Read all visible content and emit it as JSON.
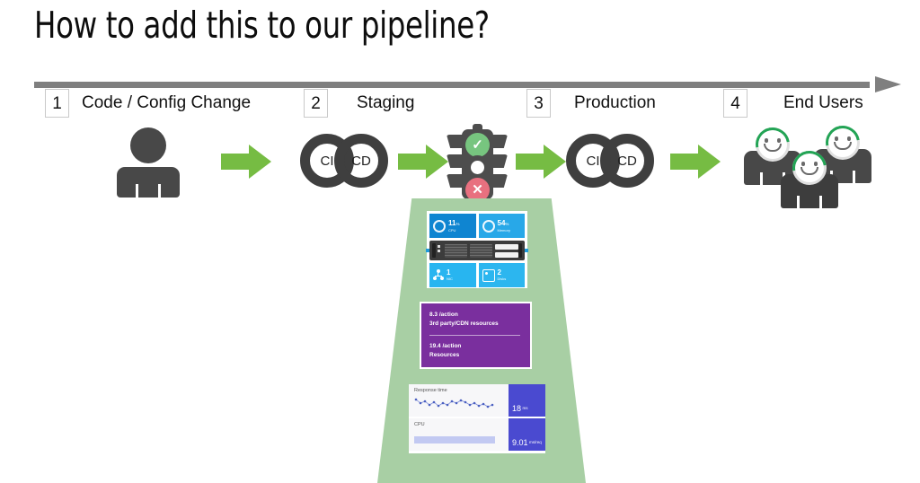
{
  "slide": {
    "title": "How to add this to our pipeline?",
    "background": "#ffffff"
  },
  "colors": {
    "accent_green": "#76bc43",
    "spotlight_green": "#a8cfa4",
    "timeline_gray": "#7f7f7f",
    "icon_gray": "#484848",
    "purple": "#7a2f9e",
    "blue_dark": "#0f85d1",
    "blue_light": "#28a8e8",
    "badge_blue": "#4a4ad0",
    "status_green": "#77c57f",
    "status_red": "#e8707f",
    "arc_green": "#23a455"
  },
  "timeline": {
    "steps": [
      {
        "number": "1",
        "label": "Code / Config Change"
      },
      {
        "number": "2",
        "label": "Staging"
      },
      {
        "number": "3",
        "label": "Production"
      },
      {
        "number": "4",
        "label": "End Users"
      }
    ]
  },
  "stages": {
    "code_change": {
      "icon": "person-icon"
    },
    "ci_cd_1": {
      "left_ring": "CI",
      "right_ring": "CD"
    },
    "ci_cd_2": {
      "left_ring": "CI",
      "right_ring": "CD"
    },
    "traffic_light": {
      "green_glyph": "✓",
      "red_glyph": "✕",
      "middle_state": "off"
    },
    "end_users": {
      "count": 3,
      "expression": "smiley"
    }
  },
  "monitoring": {
    "server_card": {
      "cpu": {
        "value": "11",
        "unit": "%",
        "label": "CPU"
      },
      "memory": {
        "value": "54",
        "unit": "%",
        "label": "Memory"
      },
      "nic": {
        "value": "1",
        "unit": "",
        "label": "NIC"
      },
      "disks": {
        "value": "2",
        "unit": "",
        "label": "Disks"
      }
    },
    "resource_panel": {
      "line1_value": "8.3 /action",
      "line1_label": "3rd party/CDN resources",
      "line2_value": "19.4 /action",
      "line2_label": "Resources"
    },
    "charts": {
      "response_time": {
        "title": "Response time",
        "badge_value": "18",
        "badge_unit": "ms"
      },
      "cpu": {
        "title": "CPU",
        "badge_value": "9.01",
        "badge_unit": "ms/req",
        "bar_fill_percent": 88
      }
    }
  },
  "chart_data": {
    "type": "line",
    "title": "Response time",
    "xlabel": "",
    "ylabel": "ms",
    "x": [
      1,
      2,
      3,
      4,
      5,
      6,
      7,
      8,
      9,
      10,
      11,
      12,
      13,
      14,
      15,
      16,
      17
    ],
    "values": [
      20,
      16,
      18,
      15,
      17,
      14,
      16,
      15,
      18,
      16,
      19,
      17,
      15,
      16,
      14,
      15,
      13
    ],
    "ylim": [
      10,
      24
    ],
    "grid": false,
    "legend": "none",
    "annotations": [
      "18 ms",
      "9.01 ms/req"
    ]
  }
}
